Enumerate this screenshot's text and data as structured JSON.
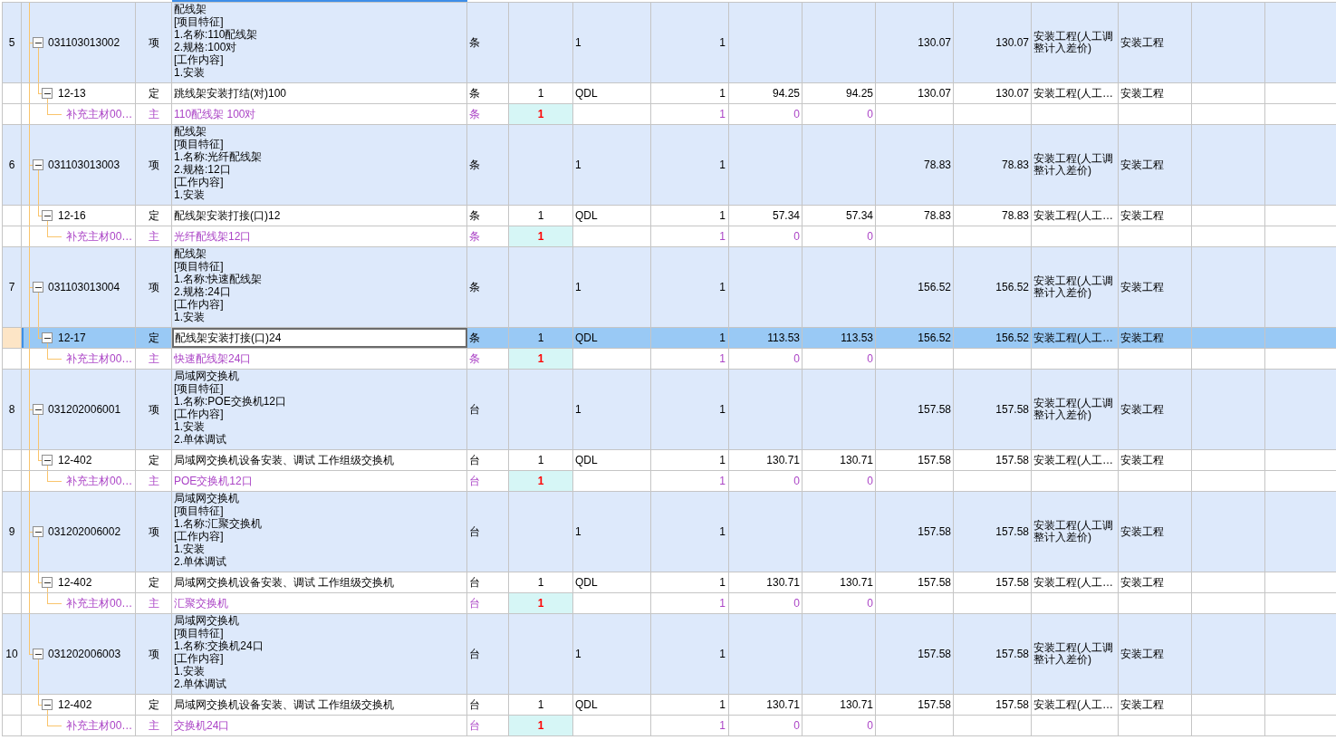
{
  "table": {
    "rows": [
      {
        "kind": "item",
        "selected": false,
        "expanded": true,
        "row_number": "5",
        "column_2": "031103013002",
        "column_3": "项",
        "column_4": "配线架\n[项目特征]\n1.名称:110配线架\n2.规格:100对\n[工作内容]\n1.安装",
        "column_5": "条",
        "column_7": "1",
        "column_8": "1",
        "column_11": "130.07",
        "column_12": "130.07",
        "column_13": "安装工程(人工调整计入差价)",
        "column_14": "安装工程",
        "children": [
          {
            "kind": "quota",
            "selected": false,
            "expanded": true,
            "column_2": "12-13",
            "column_3": "定",
            "column_4": "跳线架安装打结(对)100",
            "column_5": "条",
            "column_6": "1",
            "column_7": "QDL",
            "column_8": "1",
            "column_9": "94.25",
            "column_10": "94.25",
            "column_11": "130.07",
            "column_12": "130.07",
            "column_13": "安装工程(人工…",
            "column_14": "安装工程",
            "children": [
              {
                "kind": "material",
                "selected": false,
                "column_2": "补充主材00…",
                "column_3": "主",
                "column_4": "110配线架 100对",
                "column_5": "条",
                "column_6": "1",
                "column_8": "1",
                "column_9": "0",
                "column_10": "0"
              }
            ]
          }
        ]
      },
      {
        "kind": "item",
        "selected": false,
        "expanded": true,
        "row_number": "6",
        "column_2": "031103013003",
        "column_3": "项",
        "column_4": "配线架\n[项目特征]\n1.名称:光纤配线架\n2.规格:12口\n[工作内容]\n1.安装",
        "column_5": "条",
        "column_7": "1",
        "column_8": "1",
        "column_11": "78.83",
        "column_12": "78.83",
        "column_13": "安装工程(人工调整计入差价)",
        "column_14": "安装工程",
        "children": [
          {
            "kind": "quota",
            "selected": false,
            "expanded": true,
            "column_2": "12-16",
            "column_3": "定",
            "column_4": "配线架安装打接(口)12",
            "column_5": "条",
            "column_6": "1",
            "column_7": "QDL",
            "column_8": "1",
            "column_9": "57.34",
            "column_10": "57.34",
            "column_11": "78.83",
            "column_12": "78.83",
            "column_13": "安装工程(人工…",
            "column_14": "安装工程",
            "children": [
              {
                "kind": "material",
                "selected": false,
                "column_2": "补充主材00…",
                "column_3": "主",
                "column_4": "光纤配线架12口",
                "column_5": "条",
                "column_6": "1",
                "column_8": "1",
                "column_9": "0",
                "column_10": "0"
              }
            ]
          }
        ]
      },
      {
        "kind": "item",
        "selected": false,
        "expanded": true,
        "row_number": "7",
        "column_2": "031103013004",
        "column_3": "项",
        "column_4": "配线架\n[项目特征]\n1.名称:快速配线架\n2.规格:24口\n[工作内容]\n1.安装",
        "column_5": "条",
        "column_7": "1",
        "column_8": "1",
        "column_11": "156.52",
        "column_12": "156.52",
        "column_13": "安装工程(人工调整计入差价)",
        "column_14": "安装工程",
        "children": [
          {
            "kind": "quota",
            "selected": true,
            "expanded": true,
            "column_2": "12-17",
            "column_3": "定",
            "column_4": "配线架安装打接(口)24",
            "column_5": "条",
            "column_6": "1",
            "column_7": "QDL",
            "column_8": "1",
            "column_9": "113.53",
            "column_10": "113.53",
            "column_11": "156.52",
            "column_12": "156.52",
            "column_13": "安装工程(人工…",
            "column_14": "安装工程",
            "children": [
              {
                "kind": "material",
                "selected": false,
                "column_2": "补充主材00…",
                "column_3": "主",
                "column_4": "快速配线架24口",
                "column_5": "条",
                "column_6": "1",
                "column_8": "1",
                "column_9": "0",
                "column_10": "0"
              }
            ]
          }
        ]
      },
      {
        "kind": "item",
        "selected": false,
        "expanded": true,
        "row_number": "8",
        "column_2": "031202006001",
        "column_3": "项",
        "column_4": "局域网交换机\n[项目特征]\n1.名称:POE交换机12口\n[工作内容]\n1.安装\n2.单体调试",
        "column_5": "台",
        "column_7": "1",
        "column_8": "1",
        "column_11": "157.58",
        "column_12": "157.58",
        "column_13": "安装工程(人工调整计入差价)",
        "column_14": "安装工程",
        "children": [
          {
            "kind": "quota",
            "selected": false,
            "expanded": true,
            "column_2": "12-402",
            "column_3": "定",
            "column_4": "局域网交换机设备安装、调试 工作组级交换机",
            "column_5": "台",
            "column_6": "1",
            "column_7": "QDL",
            "column_8": "1",
            "column_9": "130.71",
            "column_10": "130.71",
            "column_11": "157.58",
            "column_12": "157.58",
            "column_13": "安装工程(人工…",
            "column_14": "安装工程",
            "children": [
              {
                "kind": "material",
                "selected": false,
                "column_2": "补充主材00…",
                "column_3": "主",
                "column_4": "POE交换机12口",
                "column_5": "台",
                "column_6": "1",
                "column_8": "1",
                "column_9": "0",
                "column_10": "0"
              }
            ]
          }
        ]
      },
      {
        "kind": "item",
        "selected": false,
        "expanded": true,
        "row_number": "9",
        "column_2": "031202006002",
        "column_3": "项",
        "column_4": "局域网交换机\n[项目特征]\n1.名称:汇聚交换机\n[工作内容]\n1.安装\n2.单体调试",
        "column_5": "台",
        "column_7": "1",
        "column_8": "1",
        "column_11": "157.58",
        "column_12": "157.58",
        "column_13": "安装工程(人工调整计入差价)",
        "column_14": "安装工程",
        "children": [
          {
            "kind": "quota",
            "selected": false,
            "expanded": true,
            "column_2": "12-402",
            "column_3": "定",
            "column_4": "局域网交换机设备安装、调试 工作组级交换机",
            "column_5": "台",
            "column_6": "1",
            "column_7": "QDL",
            "column_8": "1",
            "column_9": "130.71",
            "column_10": "130.71",
            "column_11": "157.58",
            "column_12": "157.58",
            "column_13": "安装工程(人工…",
            "column_14": "安装工程",
            "children": [
              {
                "kind": "material",
                "selected": false,
                "column_2": "补充主材00…",
                "column_3": "主",
                "column_4": "汇聚交换机",
                "column_5": "台",
                "column_6": "1",
                "column_8": "1",
                "column_9": "0",
                "column_10": "0"
              }
            ]
          }
        ]
      },
      {
        "kind": "item",
        "selected": false,
        "expanded": true,
        "row_number": "10",
        "column_2": "031202006003",
        "column_3": "项",
        "column_4": "局域网交换机\n[项目特征]\n1.名称:交换机24口\n[工作内容]\n1.安装\n2.单体调试",
        "column_5": "台",
        "column_7": "1",
        "column_8": "1",
        "column_11": "157.58",
        "column_12": "157.58",
        "column_13": "安装工程(人工调整计入差价)",
        "column_14": "安装工程",
        "children": [
          {
            "kind": "quota",
            "selected": false,
            "expanded": true,
            "column_2": "12-402",
            "column_3": "定",
            "column_4": "局域网交换机设备安装、调试 工作组级交换机",
            "column_5": "台",
            "column_6": "1",
            "column_7": "QDL",
            "column_8": "1",
            "column_9": "130.71",
            "column_10": "130.71",
            "column_11": "157.58",
            "column_12": "157.58",
            "column_13": "安装工程(人工…",
            "column_14": "安装工程",
            "children": [
              {
                "kind": "material",
                "selected": false,
                "column_2": "补充主材00…",
                "column_3": "主",
                "column_4": "交换机24口",
                "column_5": "台",
                "column_6": "1",
                "column_8": "1",
                "column_9": "0",
                "column_10": "0"
              }
            ]
          }
        ]
      }
    ]
  }
}
